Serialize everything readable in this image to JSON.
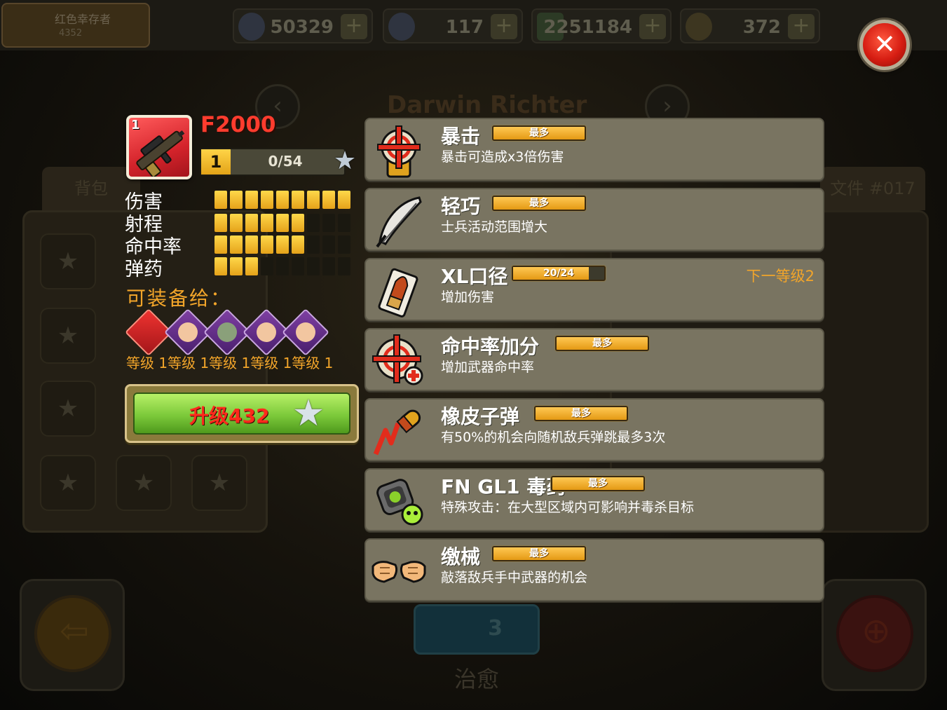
{
  "topbar": {
    "player_name": "红色幸存者",
    "player_sub": "4352",
    "resources": [
      {
        "name": "book-icon",
        "value": "50329"
      },
      {
        "name": "star-icon",
        "value": "117"
      },
      {
        "name": "cash-icon",
        "value": "2251184"
      },
      {
        "name": "coin-icon",
        "value": "372"
      }
    ],
    "plus_label": "+"
  },
  "background": {
    "title": "Darwin Richter",
    "tab_backpack": "背包",
    "tab_right": "文件 #017",
    "heal_count": "3",
    "heal_label": "治愈",
    "slot_star": "★"
  },
  "close_label": "✕",
  "weapon": {
    "icon_level": "1",
    "name": "F2000",
    "level": "1",
    "xp": "0/54",
    "stats": [
      {
        "label": "伤害",
        "value": 9,
        "max": 9
      },
      {
        "label": "射程",
        "value": 6,
        "max": 9
      },
      {
        "label": "命中率",
        "value": 6,
        "max": 9
      },
      {
        "label": "弹药",
        "value": 3,
        "max": 9
      }
    ],
    "equip_label": "可装备给：",
    "equip_levels": "等级 1等级 1等级 1等级 1等级 1",
    "upgrade_label": "升级432",
    "star_glyph": "★"
  },
  "perks": [
    {
      "name": "暴击",
      "bar": "最多",
      "desc": "暴击可造成x3倍伤害",
      "icon": "critical-hit-icon",
      "next": ""
    },
    {
      "name": "轻巧",
      "bar": "最多",
      "desc": "士兵活动范围增大",
      "icon": "feather-icon",
      "next": ""
    },
    {
      "name": "XL口径",
      "bar": "20/24",
      "desc": "增加伤害",
      "icon": "bullet-icon",
      "next": "下一等级2",
      "progress": 0.83
    },
    {
      "name": "命中率加分",
      "bar": "最多",
      "desc": "增加武器命中率",
      "icon": "accuracy-icon",
      "next": ""
    },
    {
      "name": "橡皮子弹",
      "bar": "最多",
      "desc": "有50%的机会向随机敌兵弹跳最多3次",
      "icon": "rubber-bullet-icon",
      "next": ""
    },
    {
      "name": "FN GL1 毒药",
      "bar": "最多",
      "desc": "特殊攻击：在大型区域内可影响并毒杀目标",
      "icon": "poison-grenade-icon",
      "next": ""
    },
    {
      "name": "缴械",
      "bar": "最多",
      "desc": "敲落敌兵手中武器的机会",
      "icon": "disarm-fists-icon",
      "next": ""
    }
  ],
  "colors": {
    "accent": "#f2a52a",
    "card": "#797461",
    "danger": "#ff3c2e",
    "upgrade": "#7cc93a"
  }
}
